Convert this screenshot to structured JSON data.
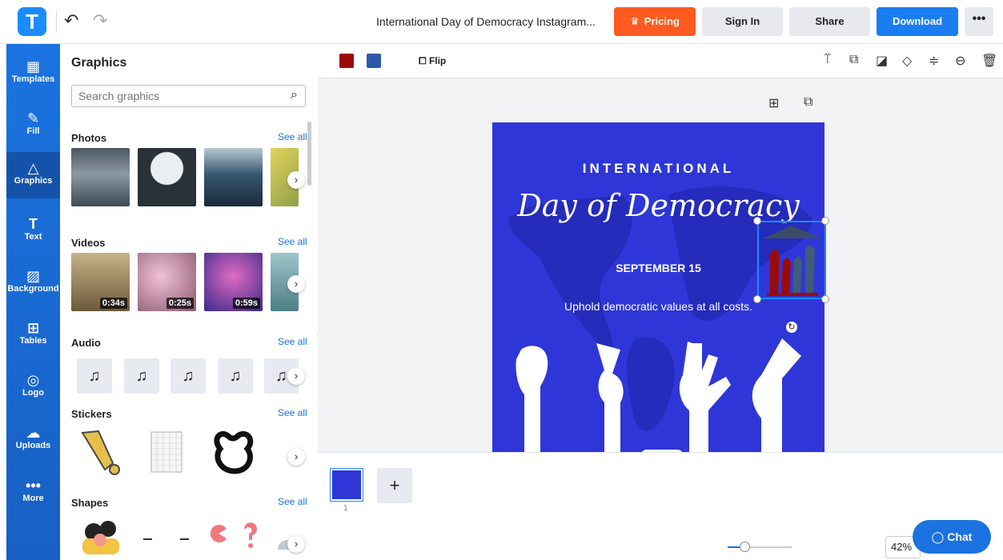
{
  "header": {
    "logo_letter": "T",
    "doc_title": "International Day of Democracy Instagram...",
    "pricing_label": "Pricing",
    "signin_label": "Sign In",
    "share_label": "Share",
    "download_label": "Download",
    "more_label": "•••"
  },
  "nav": [
    {
      "label": "Templates",
      "icon": "templates-icon"
    },
    {
      "label": "Fill",
      "icon": "pencil-icon"
    },
    {
      "label": "Graphics",
      "icon": "shapes-icon"
    },
    {
      "label": "Text",
      "icon": "text-icon"
    },
    {
      "label": "Background",
      "icon": "background-icon"
    },
    {
      "label": "Tables",
      "icon": "table-icon"
    },
    {
      "label": "Logo",
      "icon": "logo-icon"
    },
    {
      "label": "Uploads",
      "icon": "upload-icon"
    },
    {
      "label": "More",
      "icon": "more-icon"
    }
  ],
  "panel": {
    "title": "Graphics",
    "search_placeholder": "Search graphics",
    "sections": {
      "photos": {
        "title": "Photos",
        "see_all": "See all"
      },
      "videos": {
        "title": "Videos",
        "see_all": "See all",
        "durations": [
          "0:34s",
          "0:25s",
          "0:59s"
        ]
      },
      "audio": {
        "title": "Audio",
        "see_all": "See all"
      },
      "stickers": {
        "title": "Stickers",
        "see_all": "See all"
      },
      "shapes": {
        "title": "Shapes",
        "see_all": "See all"
      }
    }
  },
  "toolbar": {
    "swatch_colors": [
      "#9b0a0a",
      "#2d5aa8"
    ],
    "flip_label": "Flip"
  },
  "canvas": {
    "heading": "INTERNATIONAL",
    "script_title": "Day of Democracy",
    "date": "SEPTEMBER 15",
    "tagline": "Uphold democratic values at all costs.",
    "background": "#2f36d8"
  },
  "bottom": {
    "page_number": "1",
    "zoom": "42%",
    "chat_label": "Chat"
  }
}
